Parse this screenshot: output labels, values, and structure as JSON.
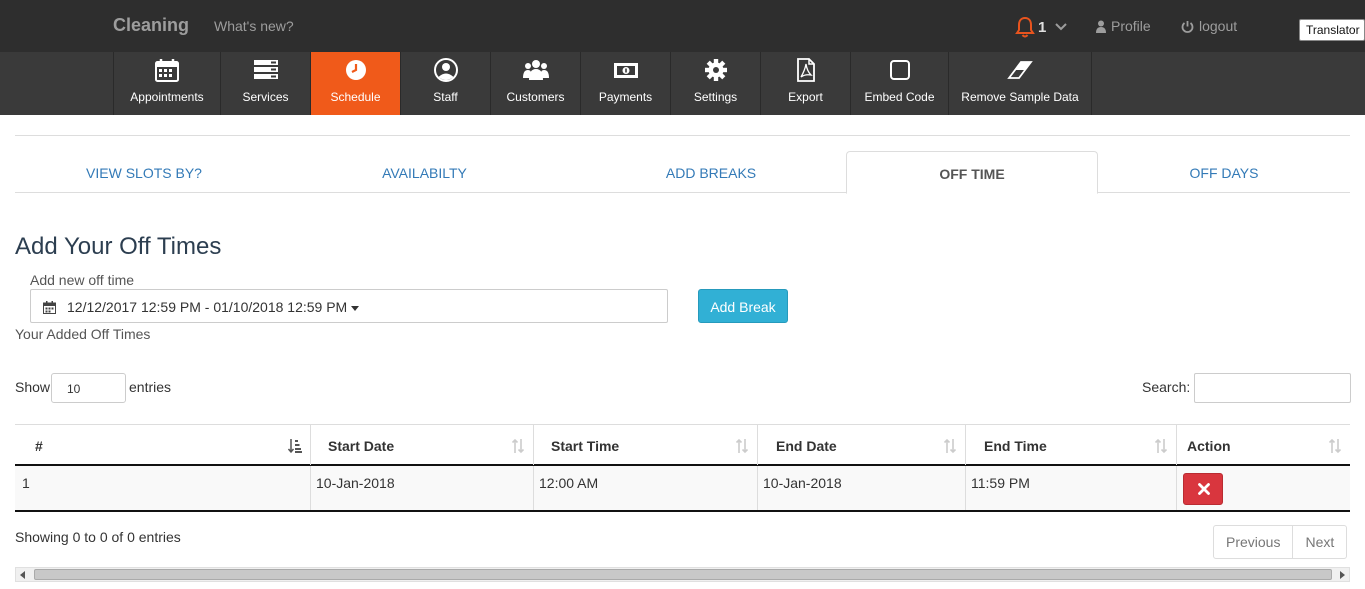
{
  "topbar": {
    "brand": "Cleaning",
    "whats_new": "What's new?",
    "notification_count": "1",
    "profile": "Profile",
    "logout": "logout",
    "translator": "Translator"
  },
  "nav": {
    "items": [
      {
        "label": "Appointments",
        "icon": "calendar-icon"
      },
      {
        "label": "Services",
        "icon": "server-icon"
      },
      {
        "label": "Schedule",
        "icon": "clock-icon"
      },
      {
        "label": "Staff",
        "icon": "user-circle-icon"
      },
      {
        "label": "Customers",
        "icon": "users-icon"
      },
      {
        "label": "Payments",
        "icon": "money-icon"
      },
      {
        "label": "Settings",
        "icon": "gear-icon"
      },
      {
        "label": "Export",
        "icon": "pdf-file-icon"
      },
      {
        "label": "Embed Code",
        "icon": "square-icon"
      },
      {
        "label": "Remove Sample Data",
        "icon": "eraser-icon"
      }
    ],
    "active": "Schedule",
    "active_color": "#f05a1a"
  },
  "tabs": {
    "items": [
      "VIEW SLOTS BY?",
      "AVAILABILTY",
      "ADD BREAKS",
      "OFF TIME",
      "OFF DAYS"
    ],
    "active": "OFF TIME"
  },
  "form": {
    "title": "Add Your Off Times",
    "new_label": "Add new off time",
    "date_range": "12/12/2017 12:59 PM - 01/10/2018 12:59 PM",
    "add_button": "Add Break",
    "added_label": "Your Added Off Times"
  },
  "table_controls": {
    "show_label": "Show",
    "entries_value": "10",
    "entries_label": "entries",
    "search_label": "Search:"
  },
  "table": {
    "columns": [
      "#",
      "Start Date",
      "Start Time",
      "End Date",
      "End Time",
      "Action"
    ],
    "rows": [
      {
        "num": "1",
        "start_date": "10-Jan-2018",
        "start_time": "12:00 AM",
        "end_date": "10-Jan-2018",
        "end_time": "11:59 PM"
      }
    ]
  },
  "footer": {
    "showing": "Showing 0 to 0 of 0 entries",
    "previous": "Previous",
    "next": "Next"
  }
}
